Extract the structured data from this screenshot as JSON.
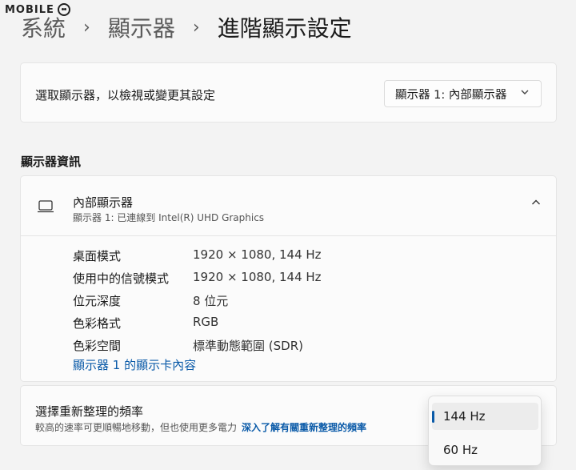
{
  "watermark": "MOBILE",
  "breadcrumb": {
    "items": [
      "系統",
      "顯示器",
      "進階顯示設定"
    ],
    "separator": "›"
  },
  "select_display": {
    "label": "選取顯示器，以檢視或變更其設定",
    "selected": "顯示器 1: 內部顯示器"
  },
  "display_info": {
    "section_title": "顯示器資訊",
    "name": "內部顯示器",
    "subtitle": "顯示器 1: 已連線到 Intel(R) UHD Graphics",
    "rows": [
      {
        "label": "桌面模式",
        "value": "1920 × 1080, 144 Hz"
      },
      {
        "label": "使用中的信號模式",
        "value": "1920 × 1080, 144 Hz"
      },
      {
        "label": "位元深度",
        "value": "8 位元"
      },
      {
        "label": "色彩格式",
        "value": "RGB"
      },
      {
        "label": "色彩空間",
        "value": "標準動態範圍 (SDR)"
      }
    ],
    "adapter_link": "顯示器 1 的顯示卡內容"
  },
  "refresh_rate": {
    "title": "選擇重新整理的頻率",
    "description": "較高的速率可更順暢地移動，但也使用更多電力",
    "learn_more": "深入了解有關重新整理的頻率",
    "options": [
      "144 Hz",
      "60 Hz"
    ],
    "selected": "144 Hz"
  },
  "colors": {
    "accent": "#0a5aa8",
    "background": "#f3f3f3",
    "card": "#fbfbfb"
  },
  "icons": {
    "monitor": "laptop-monitor-icon",
    "dropdown": "chevron-down-icon",
    "collapse": "chevron-up-icon"
  }
}
